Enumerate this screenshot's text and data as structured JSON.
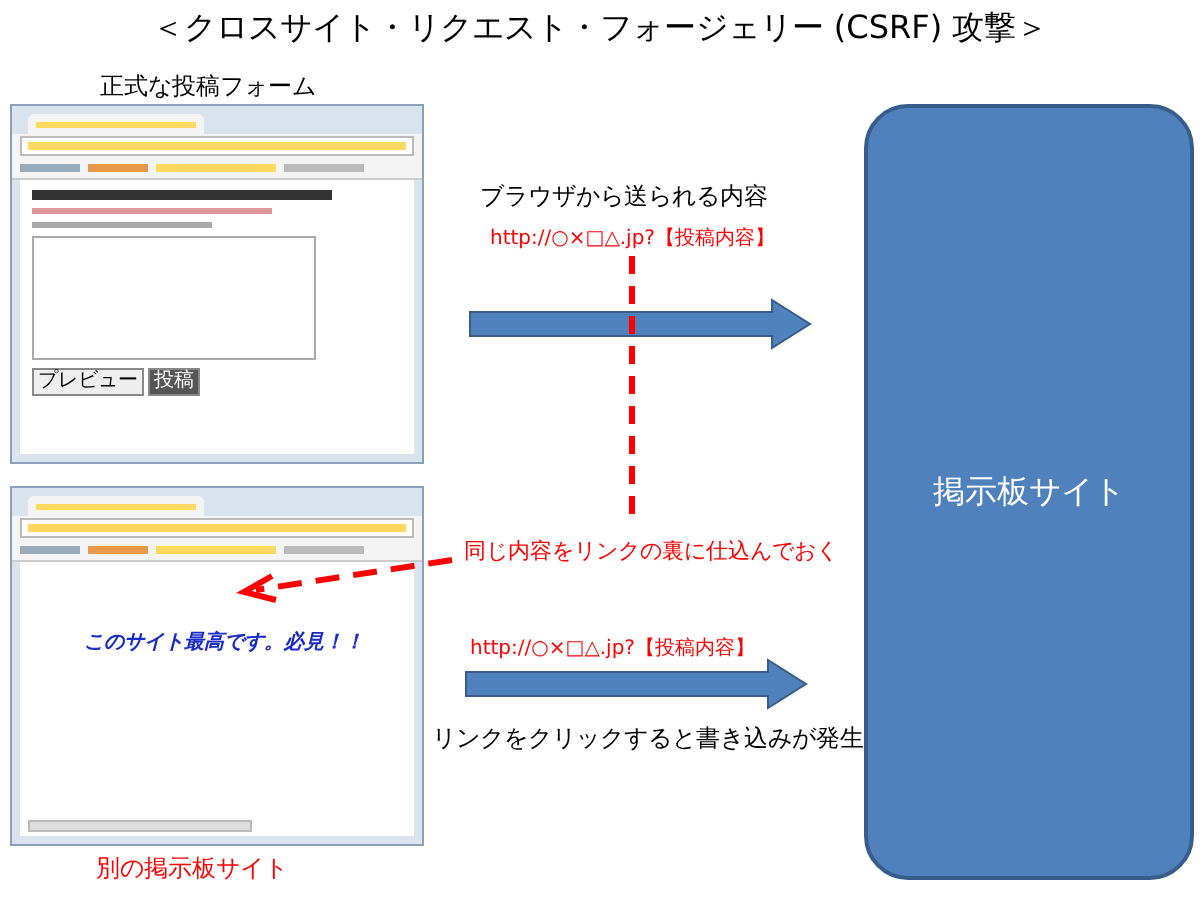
{
  "title": "＜クロスサイト・リクエスト・フォージェリー (CSRF) 攻撃＞",
  "official_form": {
    "label": "正式な投稿フォーム",
    "buttons": [
      "プレビュー",
      "投稿"
    ]
  },
  "other_site": {
    "label": "別の掲示板サイト",
    "link_text": "このサイト最高です。必見！！"
  },
  "flows": [
    {
      "caption": "ブラウザから送られる内容",
      "url": "http://○×□△.jp?【投稿内容】"
    },
    {
      "url": "http://○×□△.jp?【投稿内容】",
      "caption": "リンクをクリックすると書き込みが発生"
    }
  ],
  "hidden_link_note": "同じ内容をリンクの裏に仕込んでおく",
  "server": {
    "label": "掲示板サイト"
  }
}
